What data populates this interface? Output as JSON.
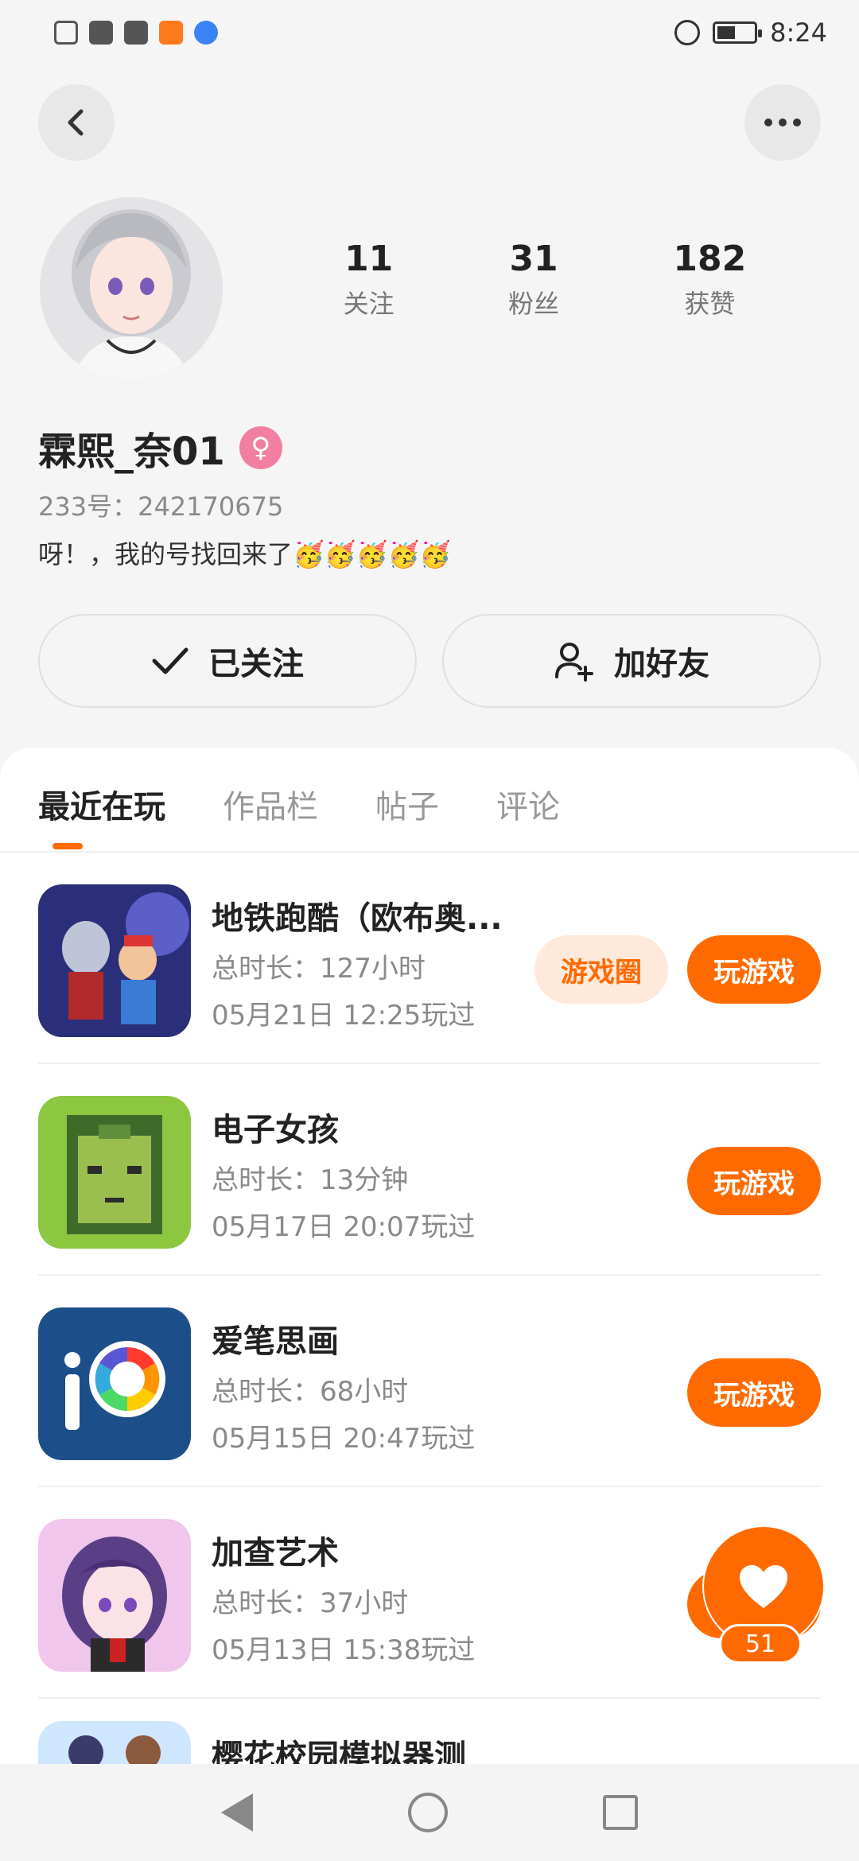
{
  "status_bar": {
    "time": "8:24",
    "icons": [
      "notification-icon",
      "wifi-icon",
      "huawei-icon",
      "video-app-icon",
      "browser-icon",
      "alarm-icon",
      "battery-icon"
    ]
  },
  "top_nav": {
    "back_icon": "back-arrow-icon",
    "more_icon": "more-icon"
  },
  "profile": {
    "stats": [
      {
        "value": "11",
        "label": "关注"
      },
      {
        "value": "31",
        "label": "粉丝"
      },
      {
        "value": "182",
        "label": "获赞"
      }
    ],
    "name": "霖熙_奈01",
    "gender": "♀",
    "id_text": "233号：242170675",
    "bio": "呀！，我的号找回来了🥳🥳🥳🥳🥳"
  },
  "actions": {
    "follow_label": "已关注",
    "add_friend_label": "加好友"
  },
  "tabs": [
    "最近在玩",
    "作品栏",
    "帖子",
    "评论"
  ],
  "games": [
    {
      "title": "地铁跑酷（欧布奥...",
      "duration": "总时长：127小时",
      "last_played": "05月21日 12:25玩过",
      "circle_label": "游戏圈",
      "play_label": "玩游戏"
    },
    {
      "title": "电子女孩",
      "duration": "总时长：13分钟",
      "last_played": "05月17日 20:07玩过",
      "play_label": "玩游戏"
    },
    {
      "title": "爱笔思画",
      "duration": "总时长：68小时",
      "last_played": "05月15日 20:47玩过",
      "play_label": "玩游戏"
    },
    {
      "title": "加查艺术",
      "duration": "总时长：37小时",
      "last_played": "05月13日 15:38玩过",
      "play_label": "玩游戏"
    },
    {
      "title": "樱花校园模拟器测"
    }
  ],
  "like": {
    "count": "51"
  },
  "colors": {
    "accent": "#ff6a00",
    "accent_light": "#ffe9da",
    "gender_pink": "#f27fa1"
  }
}
